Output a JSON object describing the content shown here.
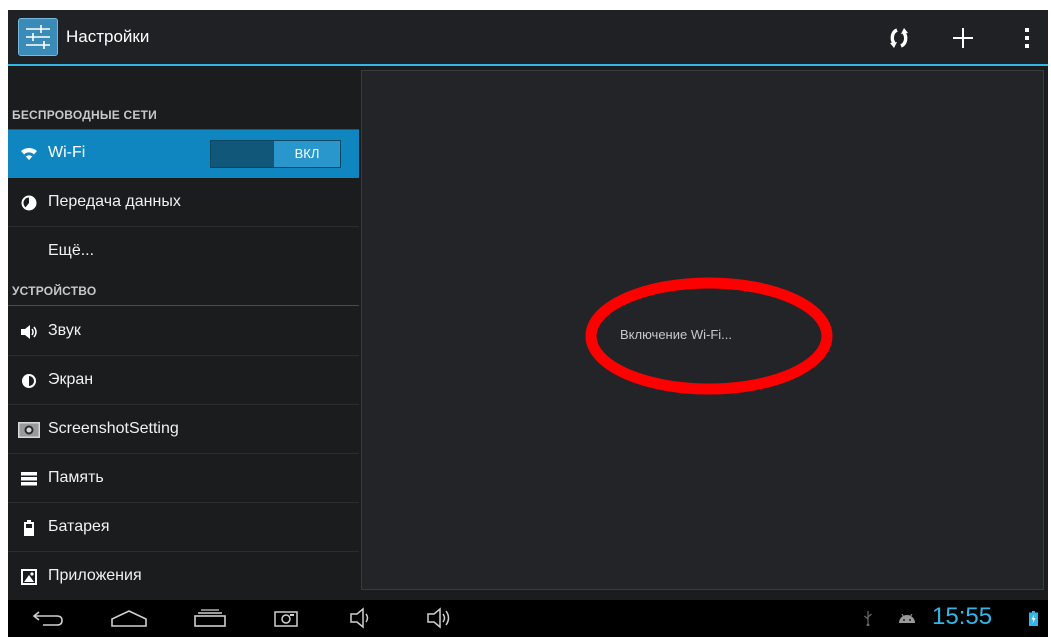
{
  "app": {
    "title": "Настройки"
  },
  "sidebar": {
    "sections": [
      {
        "header": "БЕСПРОВОДНЫЕ СЕТИ"
      },
      {
        "header": "УСТРОЙСТВО"
      }
    ],
    "items": [
      {
        "label": "Wi-Fi",
        "icon": "wifi-icon",
        "toggle": "ВКЛ",
        "active": true
      },
      {
        "label": "Передача данных",
        "icon": "data-usage-icon"
      },
      {
        "label": "Ещё..."
      },
      {
        "label": "Звук",
        "icon": "volume-icon"
      },
      {
        "label": "Экран",
        "icon": "brightness-icon"
      },
      {
        "label": "ScreenshotSetting",
        "icon": "camera-icon"
      },
      {
        "label": "Память",
        "icon": "storage-icon"
      },
      {
        "label": "Батарея",
        "icon": "battery-icon"
      },
      {
        "label": "Приложения",
        "icon": "apps-icon"
      }
    ]
  },
  "detail": {
    "status": "Включение Wi-Fi..."
  },
  "statusbar": {
    "time": "15:55"
  },
  "colors": {
    "accent": "#33b5e5",
    "selected": "#0f86c0",
    "annotation": "#ff0000"
  }
}
